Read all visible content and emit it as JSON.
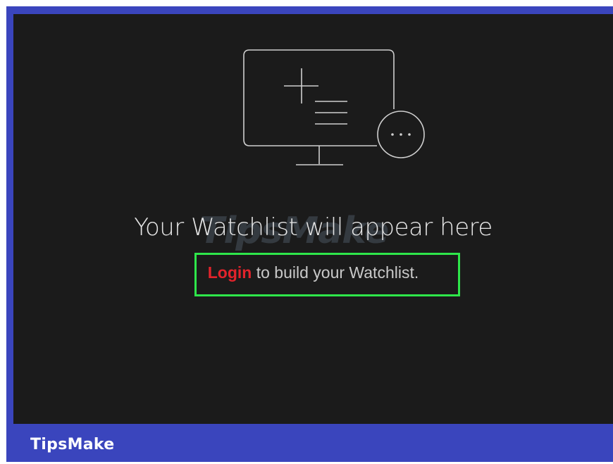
{
  "colors": {
    "frame": "#3a45bd",
    "screen": "#1b1b1b",
    "accent": "#e3232b",
    "highlight": "#2ee64a"
  },
  "illustration": {
    "icons": [
      "monitor-icon",
      "add-list-icon",
      "more-options-icon"
    ]
  },
  "watchlist": {
    "heading": "Your Watchlist will appear here",
    "login_link": "Login",
    "login_suffix": " to build your Watchlist."
  },
  "watermark": {
    "text": "TipsMake"
  },
  "brand": {
    "label": "TipsMake"
  }
}
